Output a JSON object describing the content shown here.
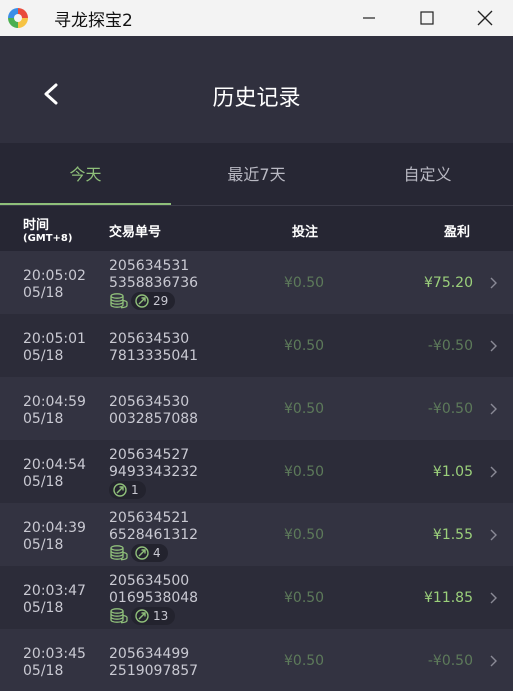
{
  "window": {
    "title": "寻龙探宝2"
  },
  "header": {
    "title": "历史记录"
  },
  "tabs": [
    {
      "label": "今天",
      "active": true
    },
    {
      "label": "最近7天",
      "active": false
    },
    {
      "label": "自定义",
      "active": false
    }
  ],
  "columns": {
    "time": "时间",
    "time_sub": "(GMT+8)",
    "order": "交易单号",
    "bet": "投注",
    "profit": "盈利"
  },
  "rows": [
    {
      "time": "20:05:02",
      "date": "05/18",
      "order_1": "205634531",
      "order_2": "5358836736",
      "bet": "¥0.50",
      "profit": "¥75.20",
      "positive": true,
      "coins": true,
      "badge": "29"
    },
    {
      "time": "20:05:01",
      "date": "05/18",
      "order_1": "205634530",
      "order_2": "7813335041",
      "bet": "¥0.50",
      "profit": "-¥0.50",
      "positive": false,
      "coins": false,
      "badge": null
    },
    {
      "time": "20:04:59",
      "date": "05/18",
      "order_1": "205634530",
      "order_2": "0032857088",
      "bet": "¥0.50",
      "profit": "-¥0.50",
      "positive": false,
      "coins": false,
      "badge": null
    },
    {
      "time": "20:04:54",
      "date": "05/18",
      "order_1": "205634527",
      "order_2": "9493343232",
      "bet": "¥0.50",
      "profit": "¥1.05",
      "positive": true,
      "coins": false,
      "badge": "1"
    },
    {
      "time": "20:04:39",
      "date": "05/18",
      "order_1": "205634521",
      "order_2": "6528461312",
      "bet": "¥0.50",
      "profit": "¥1.55",
      "positive": true,
      "coins": true,
      "badge": "4"
    },
    {
      "time": "20:03:47",
      "date": "05/18",
      "order_1": "205634500",
      "order_2": "0169538048",
      "bet": "¥0.50",
      "profit": "¥11.85",
      "positive": true,
      "coins": true,
      "badge": "13"
    },
    {
      "time": "20:03:45",
      "date": "05/18",
      "order_1": "205634499",
      "order_2": "2519097857",
      "bet": "¥0.50",
      "profit": "-¥0.50",
      "positive": false,
      "coins": false,
      "badge": null
    }
  ]
}
